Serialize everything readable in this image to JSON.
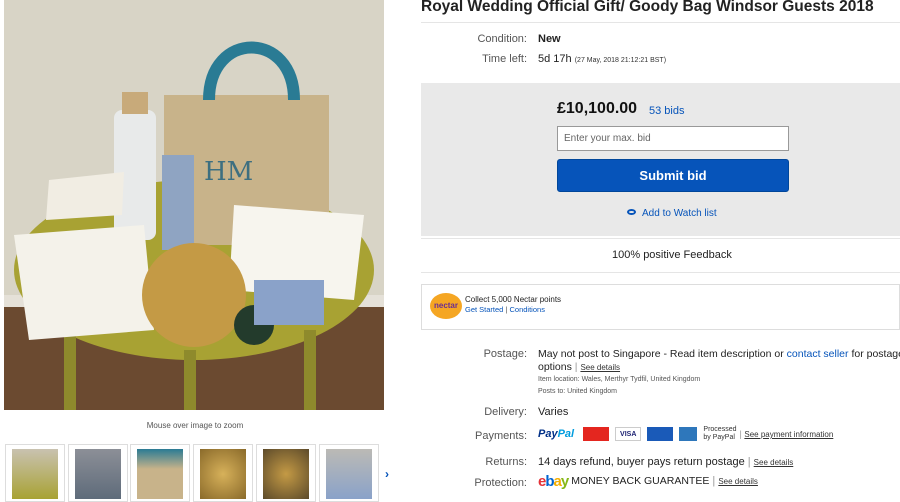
{
  "listing": {
    "title": "Royal Wedding Official Gift/ Goody Bag Windsor Guests 2018"
  },
  "gallery": {
    "zoom_hint": "Mouse over image to zoom",
    "thumbnail_count": 6,
    "next_arrow": "›"
  },
  "condition": {
    "label": "Condition:",
    "value": "New"
  },
  "time_left": {
    "label": "Time left:",
    "value": "5d 17h",
    "detail": "(27 May, 2018  21:12:21 BST)"
  },
  "bid": {
    "price": "£10,100.00",
    "bids": "53 bids",
    "input_placeholder": "Enter your max. bid",
    "submit_label": "Submit bid",
    "watch_label": "Add to Watch list"
  },
  "feedback": "100% positive Feedback",
  "nectar": {
    "logo": "nectar",
    "line1": "Collect 5,000 Nectar points",
    "get_started": "Get Started",
    "conditions": "Conditions"
  },
  "postage": {
    "label": "Postage:",
    "line1": "May not post to Singapore - Read item description or",
    "contact": "contact seller",
    "line1_end": "for postage",
    "line2": "options",
    "see_details": "See details",
    "item_location": "Item location:  Wales, Merthyr Tydfil, United Kingdom",
    "posts_to": "Posts to:  United Kingdom"
  },
  "delivery": {
    "label": "Delivery:",
    "value": "Varies"
  },
  "payments": {
    "label": "Payments:",
    "paypal_a": "Pay",
    "paypal_b": "Pal",
    "cards": [
      "MasterCard",
      "VISA",
      "Maestro",
      "AMEX"
    ],
    "processed": "Processed",
    "by_paypal": "by PayPal",
    "see_payment": "See payment information"
  },
  "returns": {
    "label": "Returns:",
    "value": "14 days refund, buyer pays return postage",
    "see_details": "See details"
  },
  "protection": {
    "label": "Protection:",
    "value": "MONEY BACK GUARANTEE",
    "see_details": "See details"
  },
  "colors": {
    "ebay_blue": "#0654ba",
    "paypal_dark": "#003087",
    "paypal_light": "#009cde"
  }
}
